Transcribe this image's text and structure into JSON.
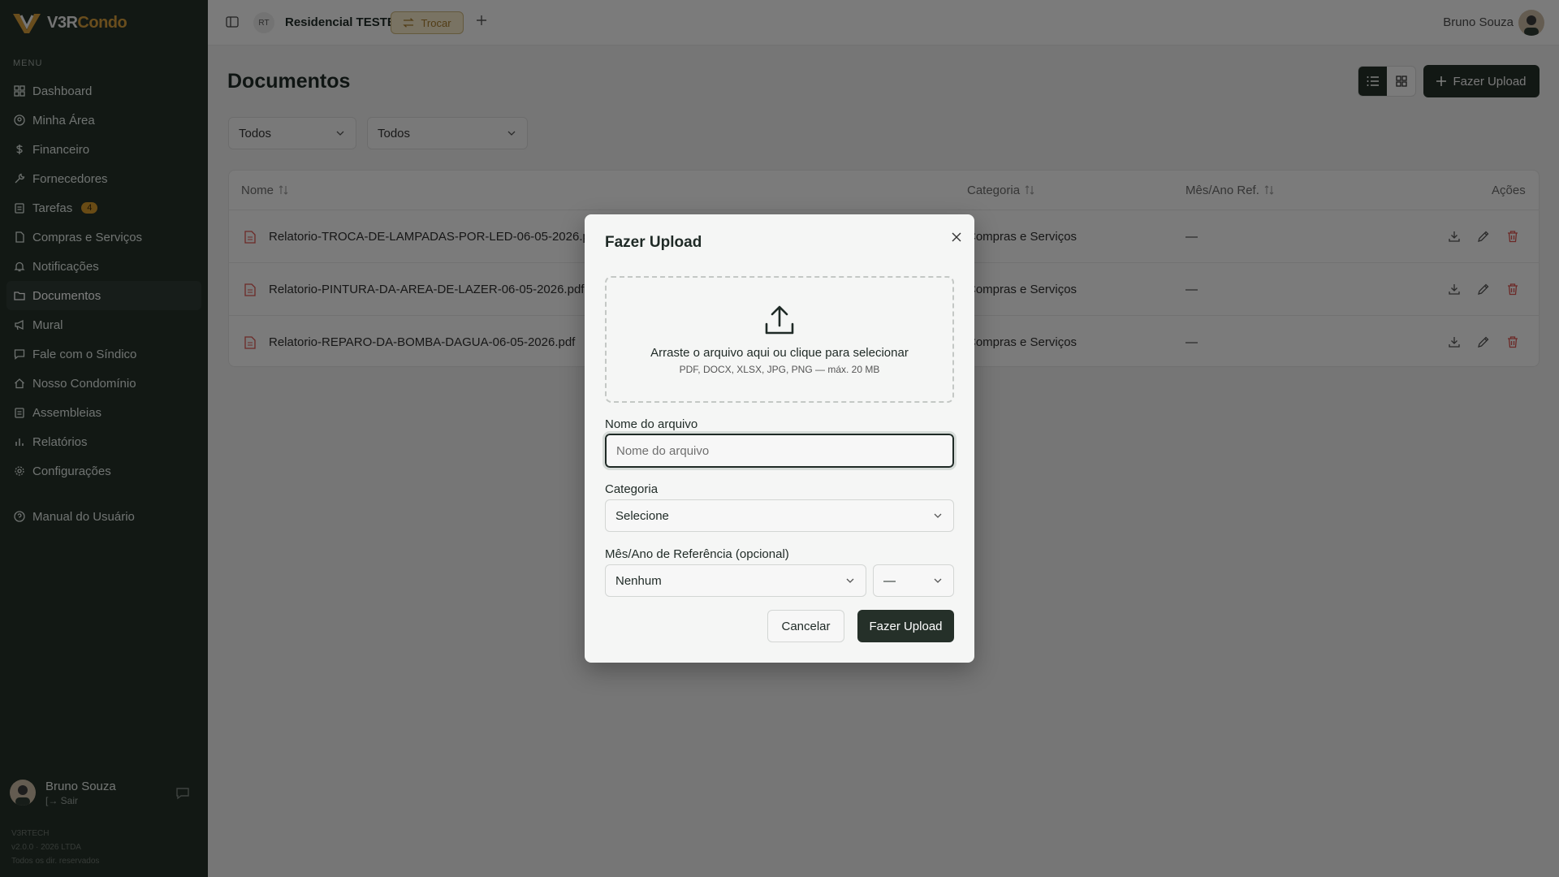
{
  "sidebar": {
    "logo_part1": "V3R",
    "logo_part2": "Condo",
    "menu_label": "MENU",
    "items": [
      {
        "label": "Dashboard",
        "icon": "grid-icon"
      },
      {
        "label": "Minha Área",
        "icon": "user-circle-icon"
      },
      {
        "label": "Financeiro",
        "icon": "dollar-icon"
      },
      {
        "label": "Fornecedores",
        "icon": "wrench-icon"
      },
      {
        "label": "Tarefas",
        "icon": "clipboard-icon",
        "badge": "4"
      },
      {
        "label": "Compras e Serviços",
        "icon": "document-icon"
      },
      {
        "label": "Notificações",
        "icon": "bell-icon"
      },
      {
        "label": "Documentos",
        "icon": "folder-icon"
      },
      {
        "label": "Mural",
        "icon": "megaphone-icon"
      },
      {
        "label": "Fale com o Síndico",
        "icon": "chat-icon"
      },
      {
        "label": "Nosso Condomínio",
        "icon": "home-icon"
      },
      {
        "label": "Assembleias",
        "icon": "clipboard-icon"
      },
      {
        "label": "Relatórios",
        "icon": "bar-chart-icon"
      },
      {
        "label": "Configurações",
        "icon": "gear-icon"
      }
    ],
    "manual": "Manual do Usuário",
    "user_name": "Bruno Souza",
    "user_action": "[→ Sair",
    "footer_1": "V3RTECH",
    "footer_2": "v2.0.0 · 2026 LTDA",
    "footer_3": "Todos os dir. reservados"
  },
  "topbar": {
    "initials": "RT",
    "condo_name": "Residencial TESTE",
    "switch_label": "Trocar",
    "user_name": "Bruno Souza"
  },
  "main": {
    "title": "Documentos",
    "upload_label": "Fazer Upload",
    "filter_1": "Todos",
    "filter_2": "Todos",
    "table": {
      "headers": {
        "name": "Nome",
        "category": "Categoria",
        "month": "Mês/Ano Ref.",
        "actions": "Ações"
      },
      "rows": [
        {
          "name": "Relatorio-TROCA-DE-LAMPADAS-POR-LED-06-05-2026.pdf",
          "category": "Compras e Serviços",
          "month": "—"
        },
        {
          "name": "Relatorio-PINTURA-DA-AREA-DE-LAZER-06-05-2026.pdf",
          "category": "Compras e Serviços",
          "month": "—"
        },
        {
          "name": "Relatorio-REPARO-DA-BOMBA-DAGUA-06-05-2026.pdf",
          "category": "Compras e Serviços",
          "month": "—"
        }
      ]
    }
  },
  "modal": {
    "title": "Fazer Upload",
    "dropzone_main": "Arraste o arquivo aqui ou clique para selecionar",
    "dropzone_sub": "PDF, DOCX, XLSX, JPG, PNG — máx. 20 MB",
    "name_label": "Nome do arquivo",
    "name_placeholder": "Nome do arquivo",
    "category_label": "Categoria",
    "category_value": "Selecione",
    "ref_label": "Mês/Ano de Referência (opcional)",
    "month_value": "Nenhum",
    "year_value": "—",
    "cancel_label": "Cancelar",
    "submit_label": "Fazer Upload"
  },
  "colors": {
    "sidebar_bg": "#253029",
    "accent": "#d29a3a",
    "danger": "#d9534f",
    "primary": "#253029"
  }
}
